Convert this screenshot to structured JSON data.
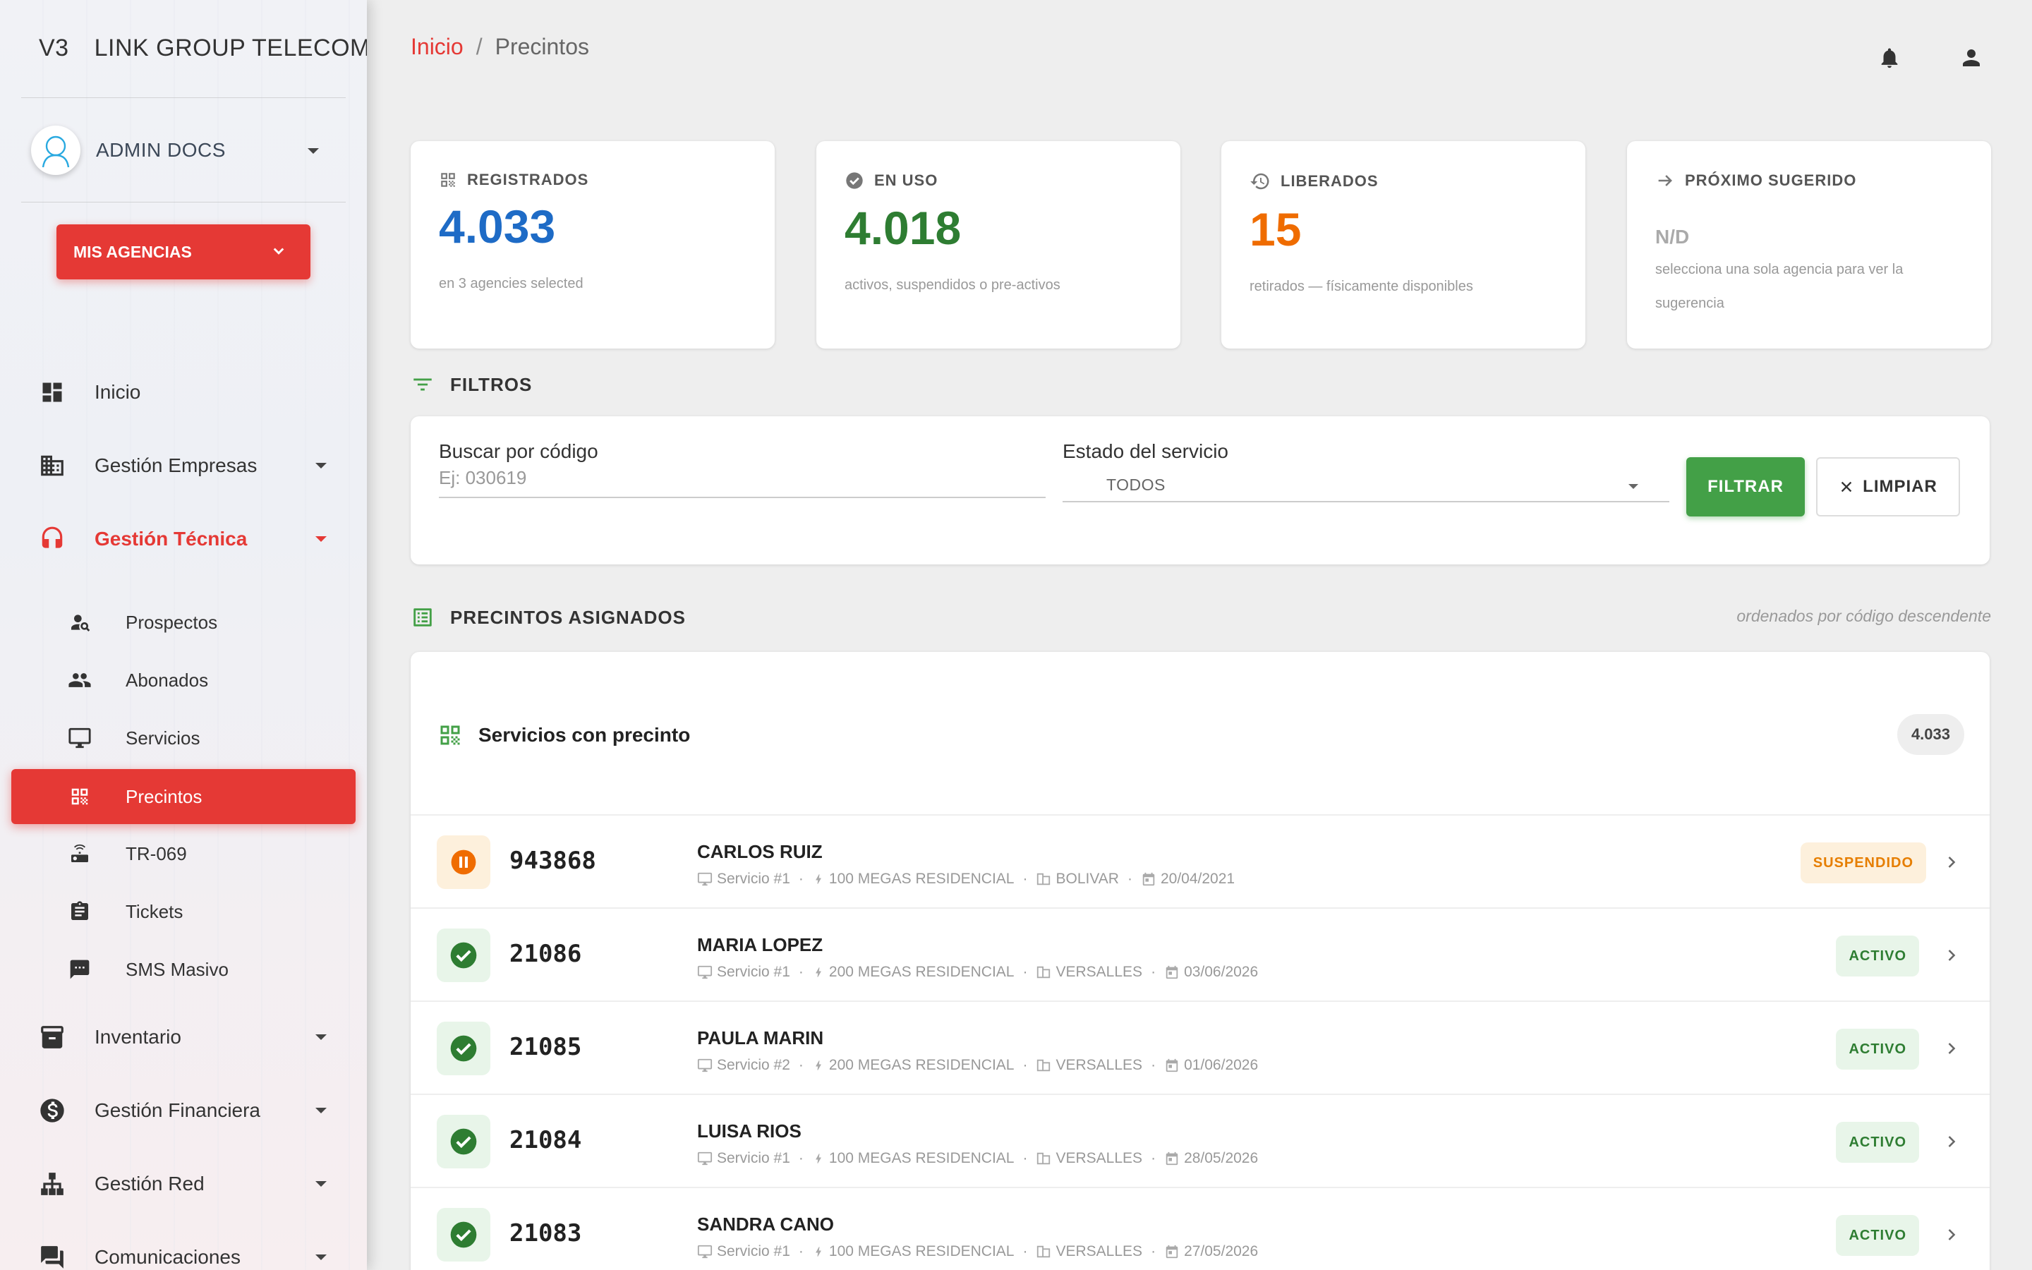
{
  "sidebar": {
    "brand_prefix": "V3",
    "brand_name": "LINK GROUP TELECOMU",
    "user_name": "ADMIN DOCS",
    "agency_button": "MIS AGENCIAS",
    "nav": [
      {
        "label": "Inicio"
      },
      {
        "label": "Gestión Empresas"
      },
      {
        "label": "Gestión Técnica"
      },
      {
        "label": "Inventario"
      },
      {
        "label": "Gestión Financiera"
      },
      {
        "label": "Gestión Red"
      },
      {
        "label": "Comunicaciones"
      }
    ],
    "subnav": [
      {
        "label": "Prospectos"
      },
      {
        "label": "Abonados"
      },
      {
        "label": "Servicios"
      },
      {
        "label": "Precintos"
      },
      {
        "label": "TR-069"
      },
      {
        "label": "Tickets"
      },
      {
        "label": "SMS Masivo"
      }
    ]
  },
  "breadcrumb": {
    "home": "Inicio",
    "separator": "/",
    "current": "Precintos"
  },
  "stats": [
    {
      "title": "REGISTRADOS",
      "value": "4.033",
      "sub": "en 3 agencies selected",
      "color": "#1e6bc6",
      "icon": "qr-code-icon"
    },
    {
      "title": "EN USO",
      "value": "4.018",
      "sub": "activos, suspendidos o pre-activos",
      "color": "#2e7d32",
      "icon": "check-circle-icon"
    },
    {
      "title": "LIBERADOS",
      "value": "15",
      "sub": "retirados — físicamente disponibles",
      "color": "#ef6c00",
      "icon": "history-icon"
    },
    {
      "title": "PRÓXIMO SUGERIDO",
      "value": "N/D",
      "sub": "selecciona una sola agencia para ver la sugerencia",
      "color": "#aaaaaa",
      "icon": "arrow-right-icon"
    }
  ],
  "filters": {
    "section_title": "FILTROS",
    "search_label": "Buscar por código",
    "search_placeholder": "Ej: 030619",
    "status_label": "Estado del servicio",
    "status_value": "TODOS",
    "filter_button": "FILTRAR",
    "clear_button": "LIMPIAR"
  },
  "assigned": {
    "section_title": "PRECINTOS ASIGNADOS",
    "sort_note": "ordenados por código descendente",
    "card_title": "Servicios con precinto",
    "count": "4.033",
    "rows": [
      {
        "code": "943868",
        "name": "CARLOS RUIZ",
        "service": "Servicio #1",
        "plan": "100 MEGAS RESIDENCIAL",
        "agency": "BOLIVAR",
        "date": "20/04/2021",
        "status": "SUSPENDIDO"
      },
      {
        "code": "21086",
        "name": "MARIA LOPEZ",
        "service": "Servicio #1",
        "plan": "200 MEGAS RESIDENCIAL",
        "agency": "VERSALLES",
        "date": "03/06/2026",
        "status": "ACTIVO"
      },
      {
        "code": "21085",
        "name": "PAULA MARIN",
        "service": "Servicio #2",
        "plan": "200 MEGAS RESIDENCIAL",
        "agency": "VERSALLES",
        "date": "01/06/2026",
        "status": "ACTIVO"
      },
      {
        "code": "21084",
        "name": "LUISA RIOS",
        "service": "Servicio #1",
        "plan": "100 MEGAS RESIDENCIAL",
        "agency": "VERSALLES",
        "date": "28/05/2026",
        "status": "ACTIVO"
      },
      {
        "code": "21083",
        "name": "SANDRA CANO",
        "service": "Servicio #1",
        "plan": "100 MEGAS RESIDENCIAL",
        "agency": "VERSALLES",
        "date": "27/05/2026",
        "status": "ACTIVO"
      }
    ]
  },
  "colors": {
    "accent": "#e53935",
    "success": "#43a047",
    "warning": "#ef6c00"
  }
}
